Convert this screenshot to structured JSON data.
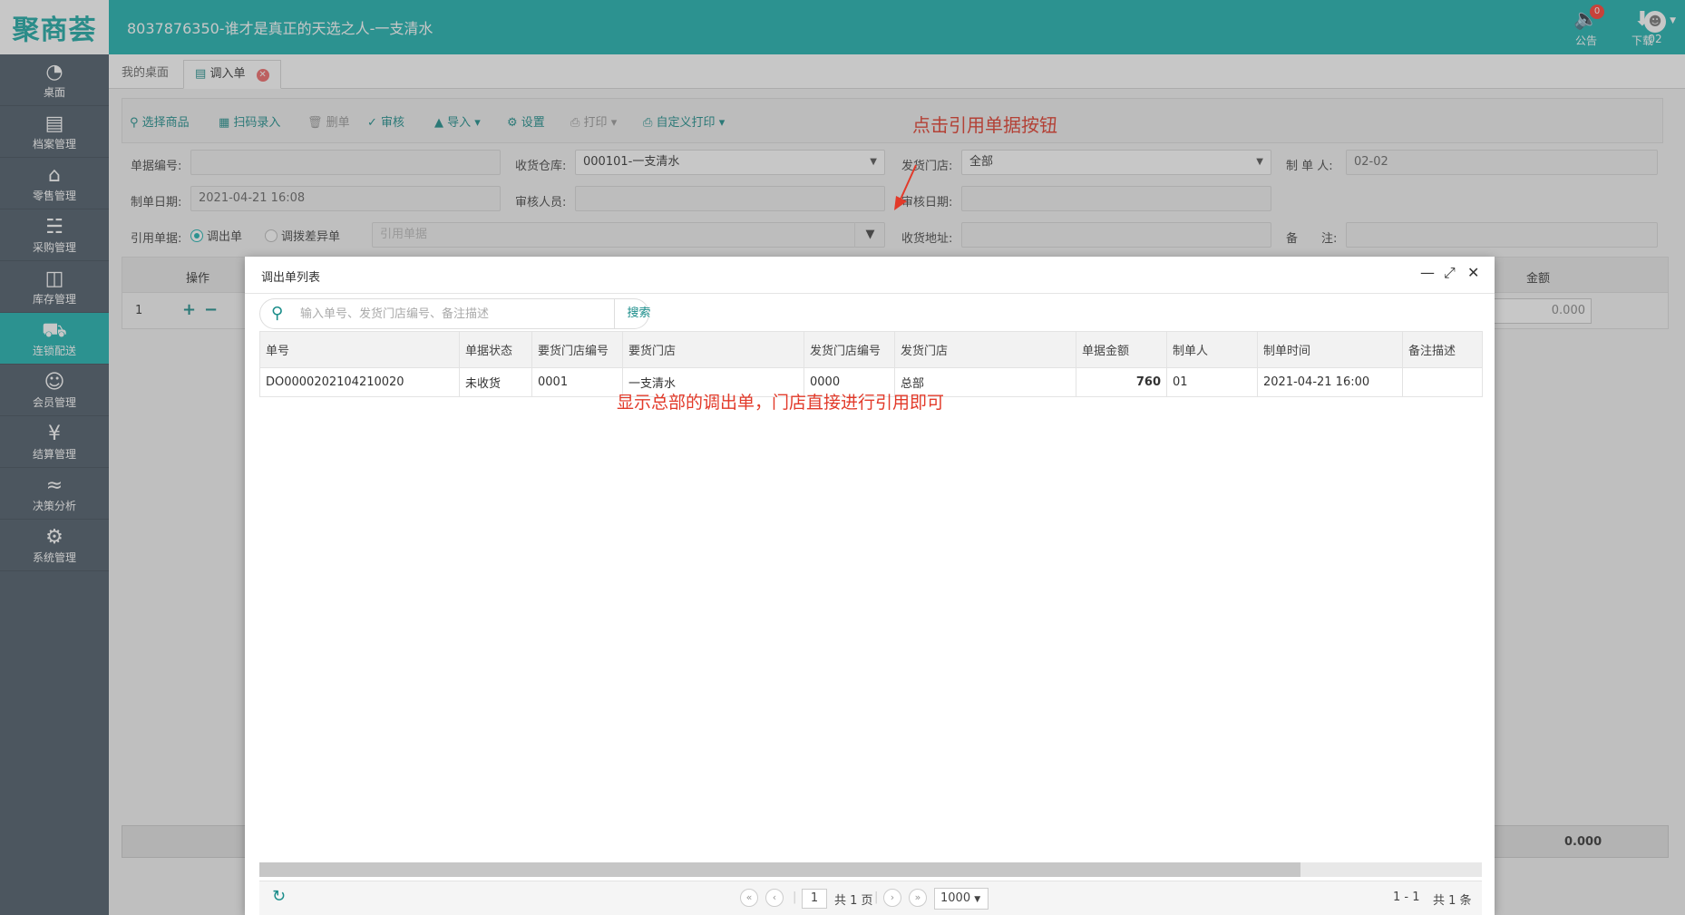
{
  "app": {
    "logo": "聚商荟",
    "title": "8037876350-谁才是真正的天选之人-一支清水",
    "notice_label": "公告",
    "notice_count": "0",
    "download_label": "下载",
    "user_label": "02"
  },
  "sidebar": {
    "items": [
      {
        "label": "桌面",
        "icon": "dashboard-icon"
      },
      {
        "label": "档案管理",
        "icon": "archive-icon"
      },
      {
        "label": "零售管理",
        "icon": "store-icon"
      },
      {
        "label": "采购管理",
        "icon": "cart-icon"
      },
      {
        "label": "库存管理",
        "icon": "inventory-icon"
      },
      {
        "label": "连锁配送",
        "icon": "truck-icon"
      },
      {
        "label": "会员管理",
        "icon": "member-icon"
      },
      {
        "label": "结算管理",
        "icon": "settlement-icon"
      },
      {
        "label": "决策分析",
        "icon": "chart-icon"
      },
      {
        "label": "系统管理",
        "icon": "gear-icon"
      }
    ]
  },
  "tabs": [
    {
      "label": "我的桌面"
    },
    {
      "label": "调入单"
    }
  ],
  "toolbar": {
    "select_goods": "选择商品",
    "scan_entry": "扫码录入",
    "delete": "删单",
    "audit": "审核",
    "import": "导入",
    "settings": "设置",
    "print": "打印",
    "custom_print": "自定义打印"
  },
  "annotations": {
    "top": "点击引用单据按钮",
    "middle": "显示总部的调出单，门店直接进行引用即可"
  },
  "form": {
    "doc_no_label": "单据编号:",
    "doc_no_value": "",
    "warehouse_label": "收货仓库:",
    "warehouse_value": "000101-一支清水",
    "ship_store_label": "发货门店:",
    "ship_store_value": "全部",
    "maker_label": "制 单 人:",
    "maker_value": "02-02",
    "date_label": "制单日期:",
    "date_value": "2021-04-21 16:08",
    "auditor_label": "审核人员:",
    "auditor_value": "",
    "audit_date_label": "审核日期:",
    "audit_date_value": "",
    "ref_label": "引用单据:",
    "ref_opt1": "调出单",
    "ref_opt2": "调拨差异单",
    "ref_placeholder": "引用单据",
    "address_label": "收货地址:",
    "address_value": "",
    "note_label": "备　　注:",
    "note_value": ""
  },
  "grid": {
    "op_header": "操作",
    "amount_header": "金额",
    "row_no": "1",
    "add": "+",
    "remove": "−",
    "amount_value": "0.000",
    "footer_total": "0.000"
  },
  "modal": {
    "title": "调出单列表",
    "search_placeholder": "输入单号、发货门店编号、备注描述",
    "search_button": "搜索",
    "columns": [
      "单号",
      "单据状态",
      "要货门店编号",
      "要货门店",
      "发货门店编号",
      "发货门店",
      "单据金额",
      "制单人",
      "制单时间",
      "备注描述"
    ],
    "rows": [
      [
        "DO0000202104210020",
        "未收货",
        "0001",
        "一支清水",
        "0000",
        "总部",
        "760",
        "01",
        "2021-04-21 16:00",
        ""
      ]
    ],
    "pager": {
      "page": "1",
      "total_pages": "共 1 页",
      "page_size": "1000",
      "range": "1 - 1",
      "total_items": "共 1 条"
    }
  }
}
